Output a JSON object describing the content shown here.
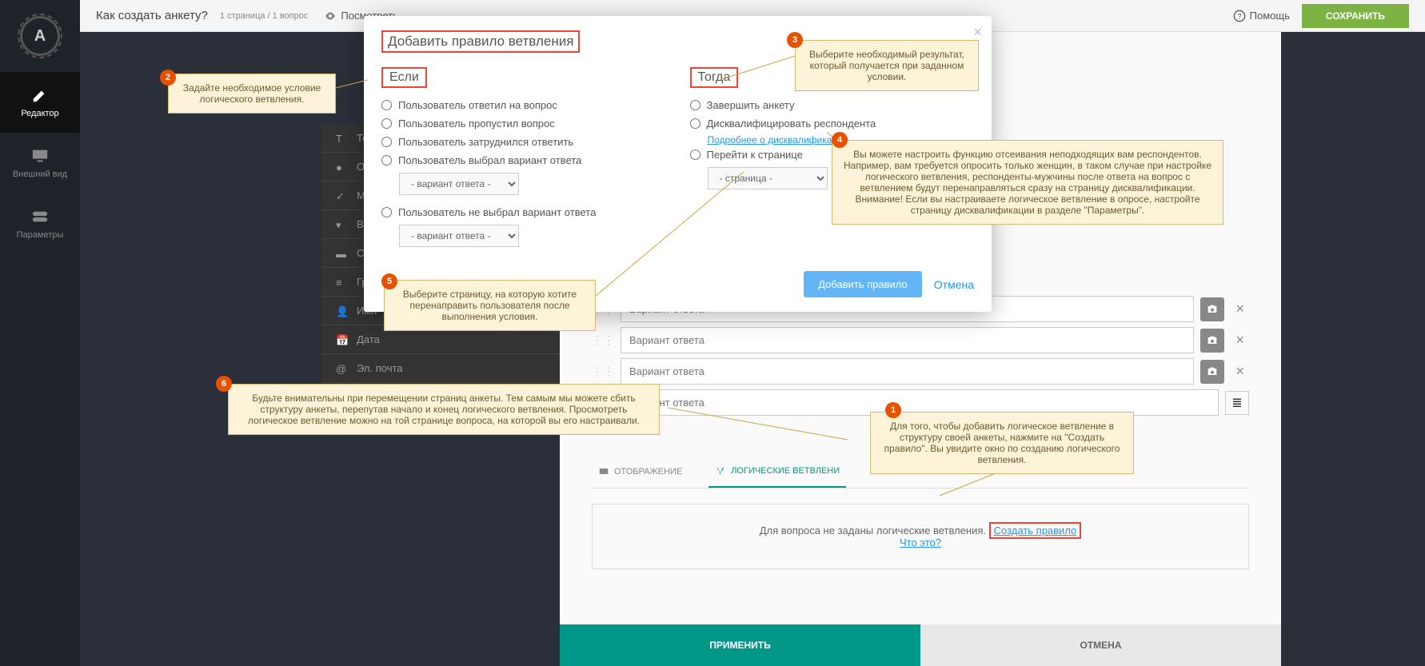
{
  "sidebar": {
    "logo": "A",
    "items": [
      {
        "label": "Редактор"
      },
      {
        "label": "Внешний вид"
      },
      {
        "label": "Параметры"
      }
    ]
  },
  "topbar": {
    "title": "Как создать анкету?",
    "sub": "1 страница / 1 вопрос",
    "preview": "Посмотреть",
    "help": "Помощь",
    "save": "СОХРАНИТЬ"
  },
  "qtypes": [
    "Те",
    "Од",
    "Мн",
    "Вы",
    "Св",
    "Группа",
    "Имя",
    "Дата",
    "Эл. почта"
  ],
  "answers": {
    "ph": "Вариант ответа"
  },
  "tabs": {
    "display": "ОТОБРАЖЕНИЕ",
    "branch": "ЛОГИЧЕСКИЕ ВЕТВЛЕНИ"
  },
  "branchbox": {
    "text": "Для вопроса не заданы логические ветвления.",
    "create": "Создать правило",
    "what": "Что это?"
  },
  "actions": {
    "apply": "ПРИМЕНИТЬ",
    "cancel": "ОТМЕНА"
  },
  "modal": {
    "title": "Добавить правило ветвления",
    "if": "Если",
    "then": "Тогда",
    "ifopts": [
      "Пользователь ответил на вопрос",
      "Пользователь пропустил вопрос",
      "Пользователь затруднился ответить",
      "Пользователь выбрал вариант ответа",
      "Пользователь не выбрал вариант ответа"
    ],
    "sel1": "- вариант ответа -",
    "sel2": "- вариант ответа -",
    "thenopts": [
      "Завершить анкету",
      "Дисквалифицировать респондента",
      "Перейти к странице"
    ],
    "disqlink": "Подробнее о дисквалификации",
    "selpage": "- страница -",
    "add": "Добавить правило",
    "cancel": "Отмена"
  },
  "annot": {
    "a1": "Для того, чтобы добавить логическое ветвление в структуру своей анкеты, нажмите на \"Создать правило\". Вы увидите окно по созданию логического ветвления.",
    "a2": "Задайте необходимое условие логического ветвления.",
    "a3": "Выберите необходимый результат, который получается при заданном условии.",
    "a4": "Вы можете настроить функцию отсеивания неподходящих вам респондентов. Например, вам требуется опросить только женщин, в таком случае при настройке логического ветвления, респонденты-мужчины после ответа на вопрос с ветвлением будут перенаправляться сразу на страницу дисквалификации.\nВнимание! Если вы настраиваете логическое ветвление в опросе, настройте страницу дисквалификации в разделе \"Параметры\".",
    "a5": "Выберите страницу, на которую хотите перенаправить пользователя после выполнения условия.",
    "a6": "Будьте внимательны при перемещении страниц анкеты. Тем самым мы можете сбить структуру анкеты, перепутав начало и конец логического ветвления.\nПросмотреть логическое ветвление можно на той странице вопроса, на которой вы его настраивали."
  }
}
